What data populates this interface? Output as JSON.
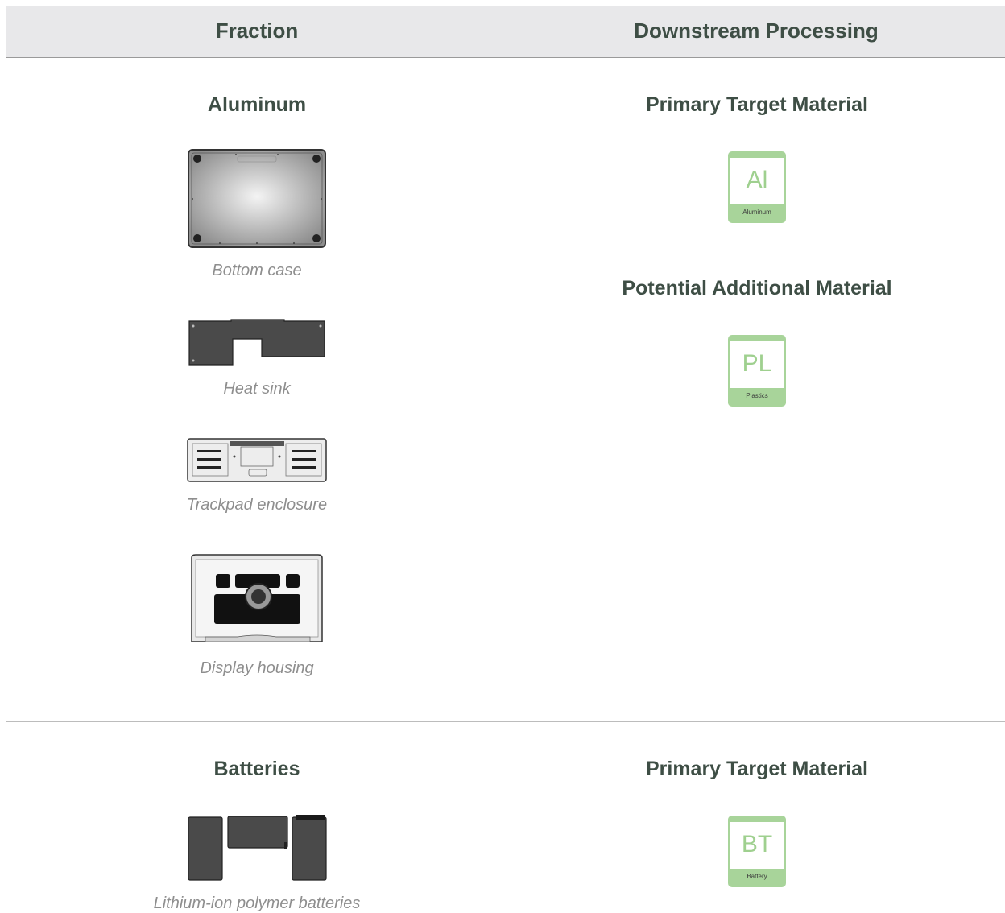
{
  "header": {
    "fraction": "Fraction",
    "downstream": "Downstream Processing"
  },
  "sections": [
    {
      "title": "Aluminum",
      "items": [
        {
          "caption": "Bottom case",
          "icon": "bottom-case-image"
        },
        {
          "caption": "Heat sink",
          "icon": "heat-sink-image"
        },
        {
          "caption": "Trackpad enclosure",
          "icon": "trackpad-enclosure-image"
        },
        {
          "caption": "Display housing",
          "icon": "display-housing-image"
        }
      ],
      "processing": [
        {
          "heading": "Primary Target Material",
          "symbol": "Al",
          "name": "Aluminum"
        },
        {
          "heading": "Potential Additional Material",
          "symbol": "PL",
          "name": "Plastics"
        }
      ]
    },
    {
      "title": "Batteries",
      "items": [
        {
          "caption": "Lithium-ion polymer batteries",
          "icon": "batteries-image"
        }
      ],
      "processing": [
        {
          "heading": "Primary Target Material",
          "symbol": "BT",
          "name": "Battery"
        }
      ]
    }
  ],
  "colors": {
    "heading": "#3e4e45",
    "caption": "#8e8e8e",
    "badge_green": "#a8d49a",
    "header_bg": "#e8e8ea"
  }
}
